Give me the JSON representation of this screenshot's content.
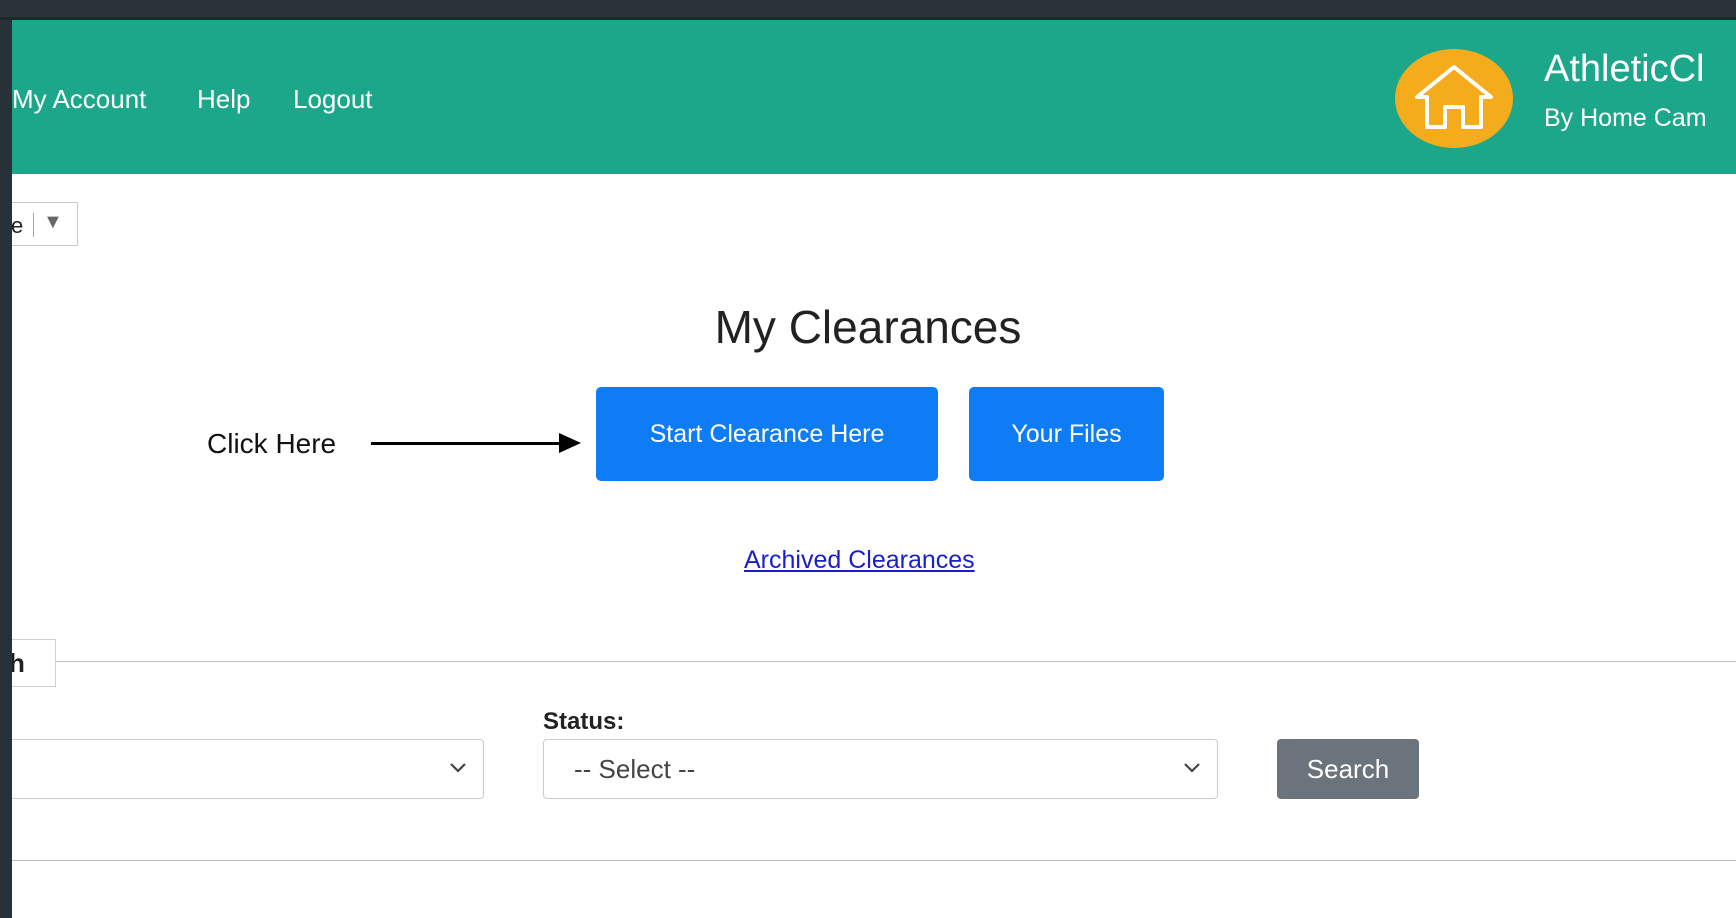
{
  "header": {
    "nav": [
      "My Account",
      "Help",
      "Logout"
    ],
    "brand_title": "AthleticCl",
    "brand_subtitle": "By Home Cam",
    "logo_icon": "house-icon",
    "bg_color": "#1ca78a",
    "logo_color": "#f5ac1c"
  },
  "corner_dropdown": {
    "value": "e",
    "icon": "triangle-down-icon"
  },
  "main": {
    "title": "My Clearances",
    "annotation": "Click Here",
    "start_button": "Start Clearance Here",
    "files_button": "Your Files",
    "archived_link": "Archived Clearances",
    "button_color": "#0d7cf5"
  },
  "search": {
    "legend": "h",
    "status_label": "Status:",
    "first_select_value": "",
    "status_select_value": "-- Select --",
    "search_button": "Search"
  }
}
